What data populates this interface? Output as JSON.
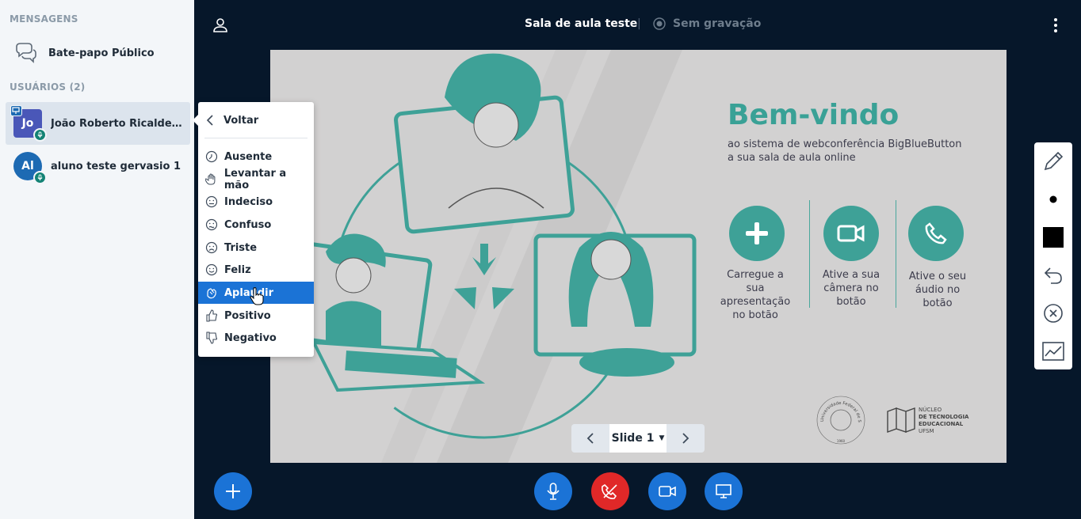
{
  "sidebar": {
    "messages_title": "MENSAGENS",
    "public_chat_label": "Bate-papo Público",
    "users_title": "USUÁRIOS (2)",
    "users": [
      {
        "initials": "Jo",
        "name": "João Roberto Ricalde G..."
      },
      {
        "initials": "Al",
        "name": "aluno teste gervasio 1"
      }
    ]
  },
  "status_menu": {
    "back_label": "Voltar",
    "items": [
      {
        "label": "Ausente",
        "icon": "clock-icon"
      },
      {
        "label": "Levantar a mão",
        "icon": "hand-icon"
      },
      {
        "label": "Indeciso",
        "icon": "neutral-face-icon"
      },
      {
        "label": "Confuso",
        "icon": "confused-face-icon"
      },
      {
        "label": "Triste",
        "icon": "sad-face-icon"
      },
      {
        "label": "Feliz",
        "icon": "happy-face-icon"
      },
      {
        "label": "Aplaudir",
        "icon": "applause-icon"
      },
      {
        "label": "Positivo",
        "icon": "thumbs-up-icon"
      },
      {
        "label": "Negativo",
        "icon": "thumbs-down-icon"
      }
    ],
    "active_index": 6
  },
  "header": {
    "room_title": "Sala de aula teste",
    "separator": "|",
    "recording_label": "Sem gravação"
  },
  "slide": {
    "welcome_title": "Bem-vindo",
    "subtitle_line1": "ao sistema de webconferência BigBlueButton",
    "subtitle_line2": "a sua sala de aula online",
    "caption_upload": "Carregue a\nsua apresentação\nno botão",
    "caption_camera": "Ative a sua\ncâmera no\nbotão",
    "caption_audio": "Ative o seu\náudio no\nbotão",
    "logo_ufsm_text": "Universidade Federal de Santa Maria",
    "logo_ufsm_year": "1960",
    "logo_nte_line1": "NÚCLEO",
    "logo_nte_line2": "DE TECNOLOGIA",
    "logo_nte_line3": "EDUCACIONAL",
    "logo_nte_line4": "UFSM"
  },
  "slide_nav": {
    "current_label": "Slide 1"
  },
  "colors": {
    "accent": "#1b73d6",
    "teal": "#3ea197",
    "danger": "#e02828",
    "dark_bg": "#06172a"
  }
}
